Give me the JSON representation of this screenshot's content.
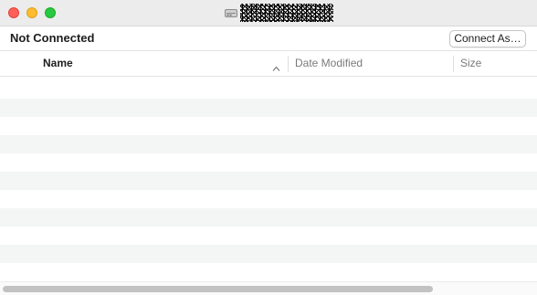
{
  "window": {
    "title_redacted": true,
    "title_icon": "network-drive-icon"
  },
  "status": {
    "text": "Not Connected",
    "connect_button_label": "Connect As…"
  },
  "columns": [
    {
      "label": "Name",
      "sorted": true,
      "sort_direction": "ascending"
    },
    {
      "label": "Date Modified",
      "sorted": false
    },
    {
      "label": "Size",
      "sorted": false
    }
  ],
  "rows": [],
  "colors": {
    "close": "#fe5f57",
    "minimize": "#febc2e",
    "maximize": "#28c840",
    "row_stripe": "#f4f5f5"
  }
}
